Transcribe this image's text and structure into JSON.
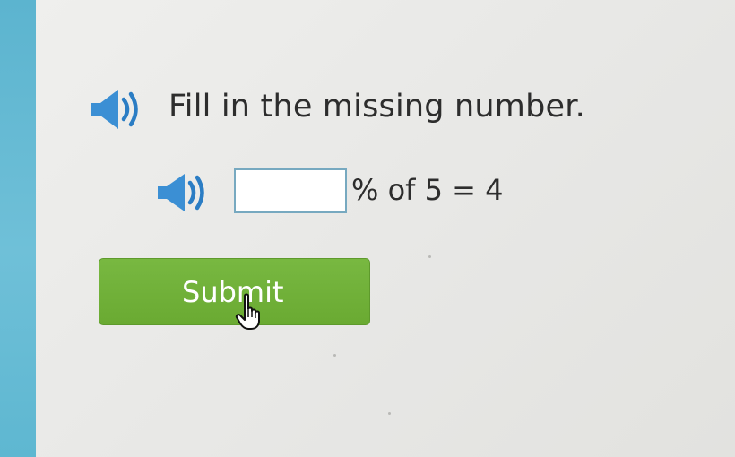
{
  "question": {
    "speaker_icon": "speaker-volume-icon",
    "text": "Fill in the missing number."
  },
  "problem": {
    "speaker_icon": "speaker-volume-icon",
    "answer_value": "",
    "suffix_text": "% of 5 = 4"
  },
  "submit": {
    "label": "Submit",
    "color": "#6fb03a"
  },
  "cursor": {
    "icon": "hand-pointer-cursor-icon"
  },
  "colors": {
    "sidebar": "#62b8d2",
    "background": "#ebebe9",
    "speaker": "#3b8fd4",
    "input_border": "#77a9c0",
    "text": "#2d2d2d"
  }
}
